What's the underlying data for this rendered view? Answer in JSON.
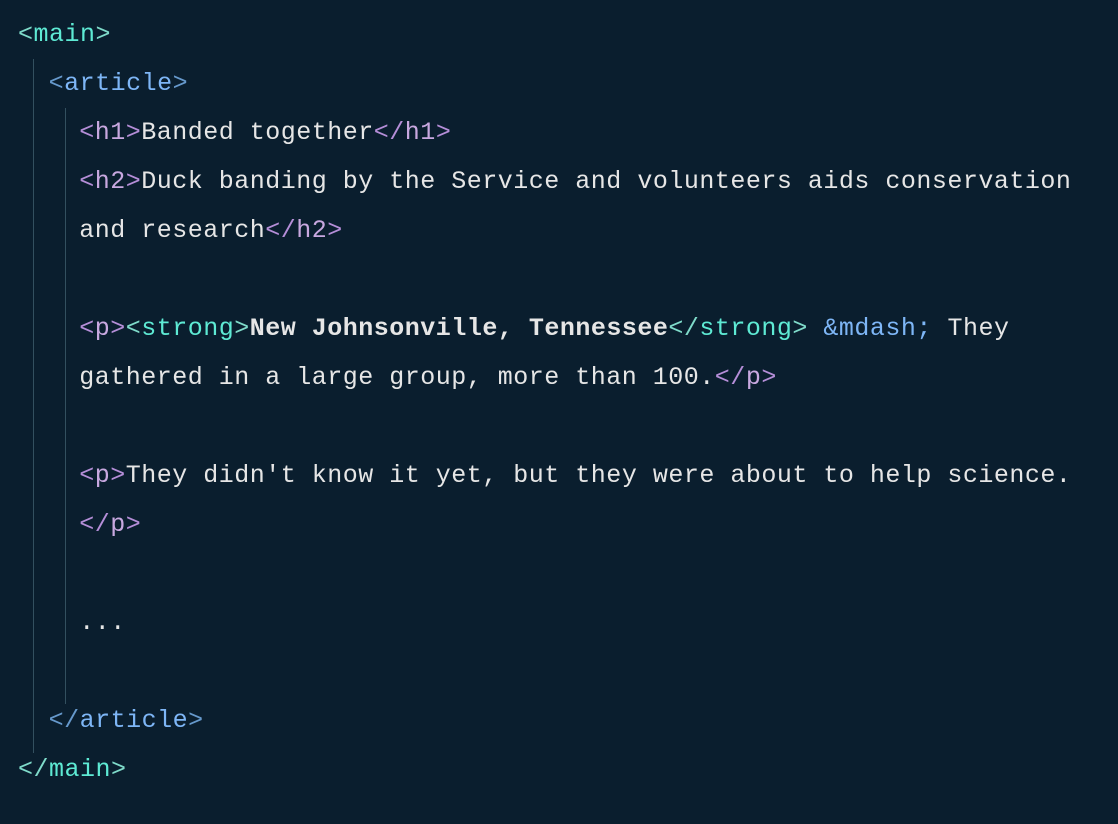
{
  "code": {
    "lines": [
      {
        "indent": 0,
        "segments": [
          {
            "type": "bracket-1",
            "text": "<"
          },
          {
            "type": "tag-name-1",
            "text": "main"
          },
          {
            "type": "bracket-1",
            "text": ">"
          }
        ]
      },
      {
        "indent": 1,
        "segments": [
          {
            "type": "bracket-2",
            "text": "<"
          },
          {
            "type": "tag-name-2",
            "text": "article"
          },
          {
            "type": "bracket-2",
            "text": ">"
          }
        ]
      },
      {
        "indent": 2,
        "segments": [
          {
            "type": "bracket-3",
            "text": "<"
          },
          {
            "type": "tag-name-3",
            "text": "h1"
          },
          {
            "type": "bracket-3",
            "text": ">"
          },
          {
            "type": "text-content",
            "text": "Banded together"
          },
          {
            "type": "bracket-3",
            "text": "</"
          },
          {
            "type": "tag-name-3",
            "text": "h1"
          },
          {
            "type": "bracket-3",
            "text": ">"
          }
        ]
      },
      {
        "indent": 2,
        "wrap": true,
        "segments": [
          {
            "type": "bracket-3",
            "text": "<"
          },
          {
            "type": "tag-name-3",
            "text": "h2"
          },
          {
            "type": "bracket-3",
            "text": ">"
          },
          {
            "type": "text-content",
            "text": "Duck banding by the Service and volunteers aids conservation and research"
          },
          {
            "type": "bracket-3",
            "text": "</"
          },
          {
            "type": "tag-name-3",
            "text": "h2"
          },
          {
            "type": "bracket-3",
            "text": ">"
          }
        ]
      },
      {
        "indent": 2,
        "blank": true
      },
      {
        "indent": 2,
        "wrap": true,
        "segments": [
          {
            "type": "bracket-3",
            "text": "<"
          },
          {
            "type": "tag-name-3",
            "text": "p"
          },
          {
            "type": "bracket-3",
            "text": ">"
          },
          {
            "type": "bracket-1",
            "text": "<"
          },
          {
            "type": "tag-name-1",
            "text": "strong"
          },
          {
            "type": "bracket-1",
            "text": ">"
          },
          {
            "type": "text-content bold-text",
            "text": "New Johnsonville, Tennessee"
          },
          {
            "type": "bracket-1",
            "text": "</"
          },
          {
            "type": "tag-name-1",
            "text": "strong"
          },
          {
            "type": "bracket-1",
            "text": ">"
          },
          {
            "type": "text-content",
            "text": " "
          },
          {
            "type": "entity",
            "text": "&mdash;"
          },
          {
            "type": "text-content",
            "text": " They gathered in a large group, more than 100."
          },
          {
            "type": "bracket-3",
            "text": "</"
          },
          {
            "type": "tag-name-3",
            "text": "p"
          },
          {
            "type": "bracket-3",
            "text": ">"
          }
        ]
      },
      {
        "indent": 2,
        "blank": true
      },
      {
        "indent": 2,
        "wrap": true,
        "segments": [
          {
            "type": "bracket-3",
            "text": "<"
          },
          {
            "type": "tag-name-3",
            "text": "p"
          },
          {
            "type": "bracket-3",
            "text": ">"
          },
          {
            "type": "text-content",
            "text": "They didn't know it yet, but they were about to help science."
          },
          {
            "type": "bracket-3",
            "text": "</"
          },
          {
            "type": "tag-name-3",
            "text": "p"
          },
          {
            "type": "bracket-3",
            "text": ">"
          }
        ]
      },
      {
        "indent": 2,
        "blank": true
      },
      {
        "indent": 2,
        "segments": [
          {
            "type": "text-content",
            "text": "..."
          }
        ]
      },
      {
        "indent": 2,
        "blank": true
      },
      {
        "indent": 1,
        "segments": [
          {
            "type": "bracket-2",
            "text": "</"
          },
          {
            "type": "tag-name-2",
            "text": "article"
          },
          {
            "type": "bracket-2",
            "text": ">"
          }
        ]
      },
      {
        "indent": 0,
        "segments": [
          {
            "type": "bracket-1",
            "text": "</"
          },
          {
            "type": "tag-name-1",
            "text": "main"
          },
          {
            "type": "bracket-1",
            "text": ">"
          }
        ]
      }
    ]
  }
}
